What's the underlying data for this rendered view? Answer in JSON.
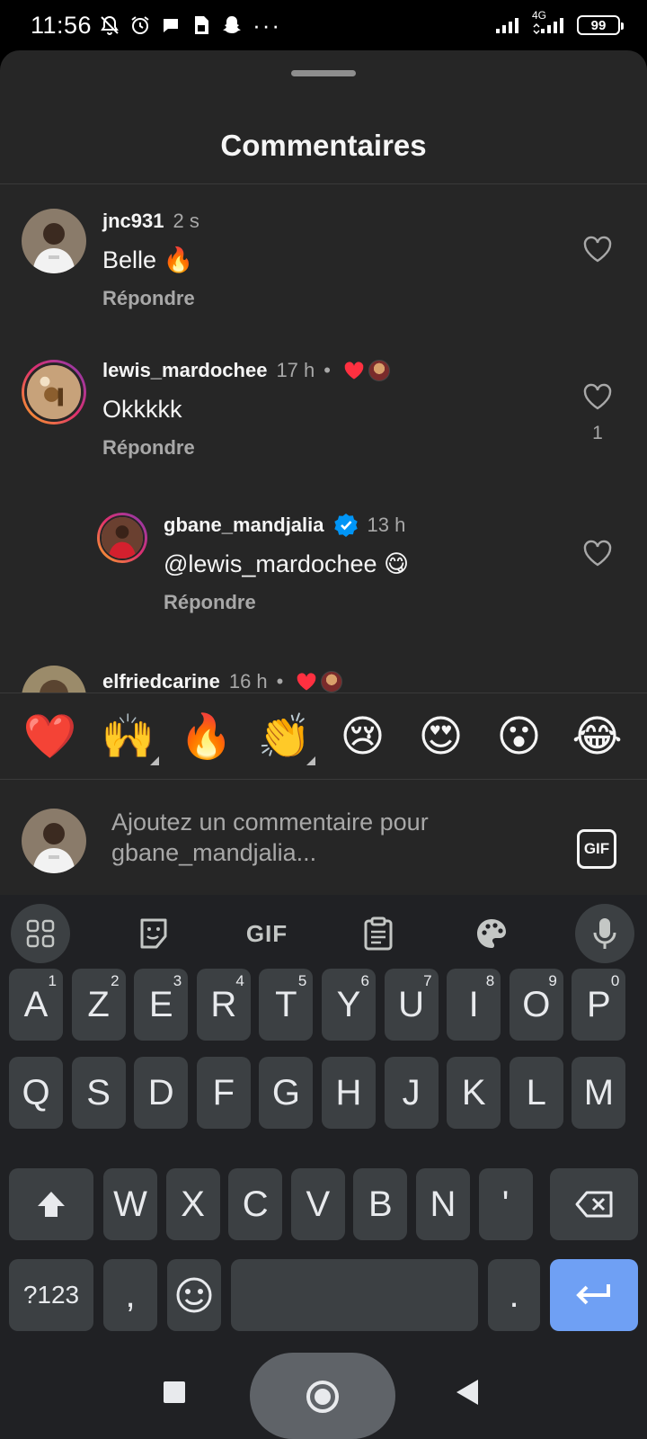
{
  "status_bar": {
    "time": "11:56",
    "network": "4G",
    "battery": "99"
  },
  "sheet": {
    "title": "Commentaires"
  },
  "comments": [
    {
      "username": "jnc931",
      "time": "2 s",
      "text": "Belle 🔥",
      "reply_label": "Répondre",
      "likes": ""
    },
    {
      "username": "lewis_mardochee",
      "time": "17 h",
      "dot": "•",
      "text": "Okkkkk",
      "reply_label": "Répondre",
      "likes": "1"
    },
    {
      "username": "gbane_mandjalia",
      "time": "13 h",
      "text": "@lewis_mardochee 😋",
      "reply_label": "Répondre",
      "likes": ""
    },
    {
      "username": "elfriedcarine",
      "time": "16 h",
      "dot": "•"
    }
  ],
  "reactions": [
    "❤️",
    "🙌",
    "🔥",
    "👏",
    "😢",
    "😍",
    "😮",
    "😂"
  ],
  "comment_input": {
    "placeholder": "Ajoutez un commentaire pour gbane_mandjalia...",
    "gif_label": "GIF"
  },
  "keyboard": {
    "toolbar_gif": "GIF",
    "row1": [
      {
        "k": "A",
        "h": "1"
      },
      {
        "k": "Z",
        "h": "2"
      },
      {
        "k": "E",
        "h": "3"
      },
      {
        "k": "R",
        "h": "4"
      },
      {
        "k": "T",
        "h": "5"
      },
      {
        "k": "Y",
        "h": "6"
      },
      {
        "k": "U",
        "h": "7"
      },
      {
        "k": "I",
        "h": "8"
      },
      {
        "k": "O",
        "h": "9"
      },
      {
        "k": "P",
        "h": "0"
      }
    ],
    "row2": [
      "Q",
      "S",
      "D",
      "F",
      "G",
      "H",
      "J",
      "K",
      "L",
      "M"
    ],
    "row3": [
      "W",
      "X",
      "C",
      "V",
      "B",
      "N",
      "'"
    ],
    "symbols_label": "?123",
    "comma": ",",
    "period": "."
  },
  "colors": {
    "sheet_bg": "#262626",
    "keyboard_bg": "#202124",
    "key_bg": "#3c4043",
    "enter_key": "#6fa0f4",
    "verified_blue": "#0095f6",
    "like_red": "#ff3040"
  }
}
